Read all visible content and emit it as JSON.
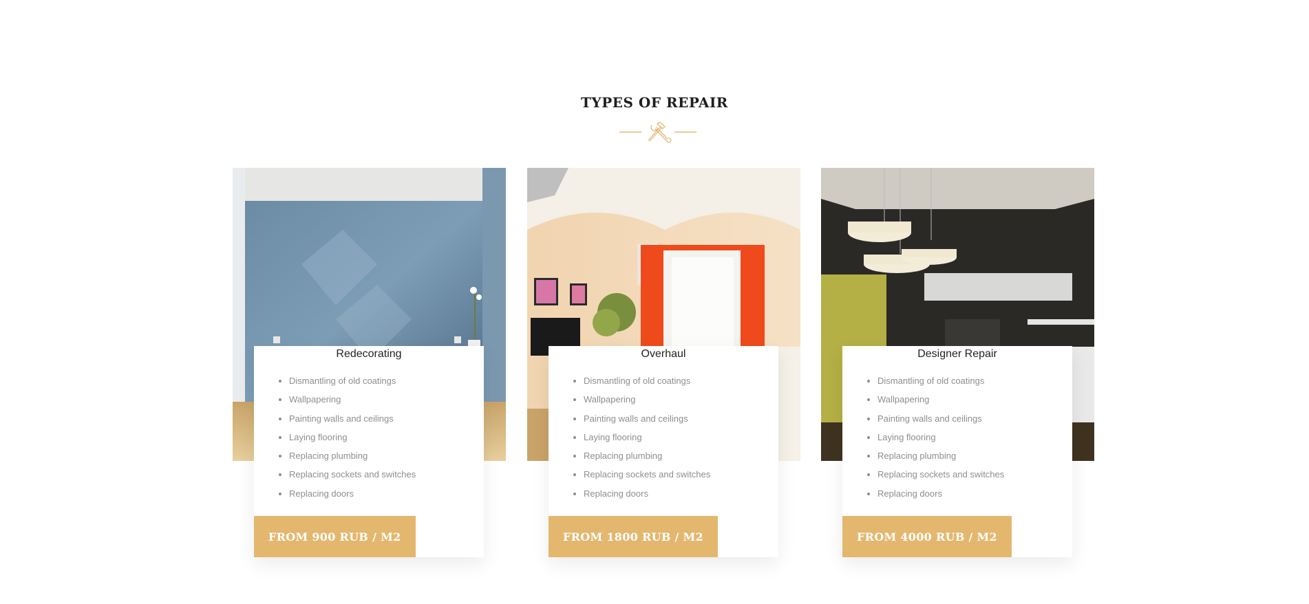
{
  "section": {
    "title": "TYPES OF REPAIR",
    "divider_icon": "hammer-wrench-icon",
    "accent_color": "#e4b76f"
  },
  "cards": [
    {
      "title": "Redecorating",
      "items": [
        "Dismantling of old coatings",
        "Wallpapering",
        "Painting walls and ceilings",
        "Laying flooring",
        "Replacing plumbing",
        "Replacing sockets and switches",
        "Replacing doors"
      ],
      "price": "FROM 900 RUB / M2"
    },
    {
      "title": "Overhaul",
      "items": [
        "Dismantling of old coatings",
        "Wallpapering",
        "Painting walls and ceilings",
        "Laying flooring",
        "Replacing plumbing",
        "Replacing sockets and switches",
        "Replacing doors"
      ],
      "price": "FROM 1800 RUB / M2"
    },
    {
      "title": "Designer Repair",
      "items": [
        "Dismantling of old coatings",
        "Wallpapering",
        "Painting walls and ceilings",
        "Laying flooring",
        "Replacing plumbing",
        "Replacing sockets and switches",
        "Replacing doors"
      ],
      "price": "FROM 4000 RUB / M2"
    }
  ]
}
